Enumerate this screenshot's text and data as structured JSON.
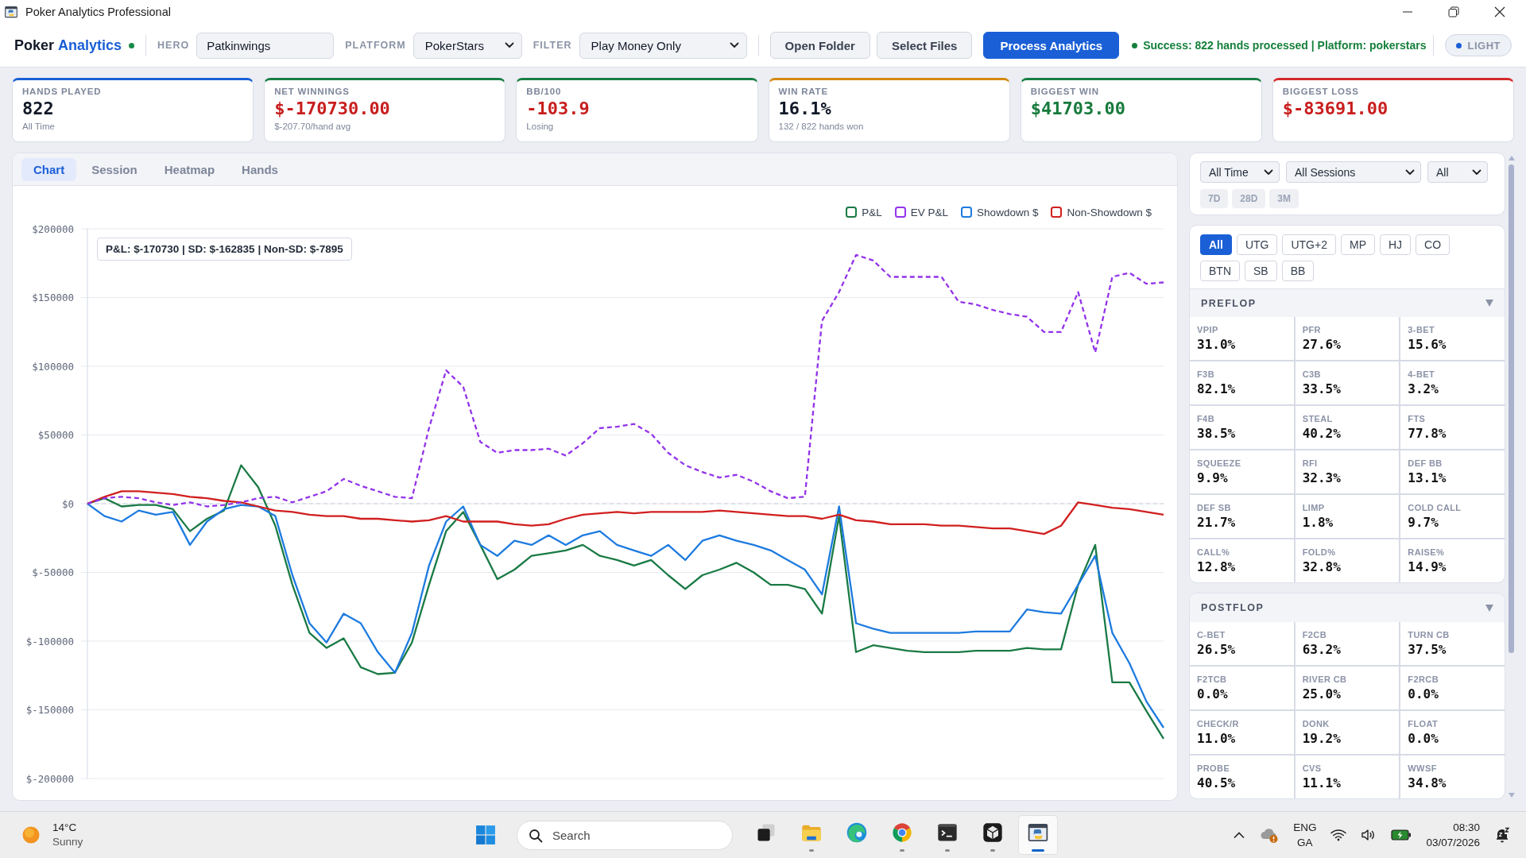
{
  "window": {
    "title": "Poker Analytics Professional"
  },
  "header": {
    "brand": {
      "name": "Poker",
      "accent": "Analytics",
      "online": true
    },
    "fields": [
      {
        "kind": "input",
        "label": "HERO",
        "value": "Patkinwings"
      },
      {
        "kind": "select",
        "label": "PLATFORM",
        "value": "PokerStars"
      },
      {
        "kind": "select",
        "label": "FILTER",
        "value": "Play Money Only"
      }
    ],
    "buttons": [
      {
        "label": "Open Folder",
        "kind": "secondary"
      },
      {
        "label": "Select Files",
        "kind": "secondary"
      },
      {
        "label": "Process Analytics",
        "kind": "primary"
      }
    ],
    "status": {
      "kind": "success",
      "text": "Success: 822 hands processed | Platform: pokerstars"
    },
    "theme_toggle": {
      "label": "LIGHT"
    }
  },
  "stats": [
    {
      "label": "HANDS PLAYED",
      "value": "822",
      "sub": "All Time",
      "color": "#1a5fd6",
      "kind": "neutral"
    },
    {
      "label": "NET WINNINGS",
      "value": "$-170730.00",
      "sub": "$-207.70/hand avg",
      "color": "#1a7f45",
      "kind": "negative"
    },
    {
      "label": "BB/100",
      "value": "-103.9",
      "sub": "Losing",
      "color": "#1a7f45",
      "kind": "negative"
    },
    {
      "label": "WIN RATE",
      "value": "16.1%",
      "sub": "132 / 822 hands won",
      "color": "#d4880f",
      "kind": "neutral"
    },
    {
      "label": "BIGGEST WIN",
      "value": "$41703.00",
      "color": "#1a7f45",
      "kind": "positive"
    },
    {
      "label": "BIGGEST LOSS",
      "value": "$-83691.00",
      "color": "#d42a2a",
      "kind": "negative"
    }
  ],
  "chart_panel": {
    "tabs": [
      {
        "label": "Chart",
        "selected": true
      },
      {
        "label": "Session",
        "selected": false
      },
      {
        "label": "Heatmap",
        "selected": false
      },
      {
        "label": "Hands",
        "selected": false
      }
    ],
    "summary": "P&L: $-170730 | SD: $-162835 | Non-SD: $-7895",
    "chart_data": {
      "type": "line",
      "categories": [
        null,
        null,
        null,
        null,
        null,
        null,
        null,
        null,
        null,
        null,
        null,
        null,
        null,
        null,
        null,
        null,
        null,
        null,
        null,
        null,
        null,
        null,
        null,
        null,
        null,
        null,
        null,
        null,
        null,
        null,
        null,
        null,
        null,
        null,
        null,
        null,
        null,
        null,
        null,
        null,
        null,
        null,
        null,
        null,
        null,
        null,
        null,
        null,
        null,
        null,
        null,
        null,
        null,
        null,
        null,
        null,
        null,
        null,
        null,
        null,
        null,
        null,
        null,
        null
      ],
      "ylim": [
        -200000,
        200000
      ],
      "yticks": [
        {
          "value": 200000,
          "label": "$200000"
        },
        {
          "value": 150000,
          "label": "$150000"
        },
        {
          "value": 100000,
          "label": "$100000"
        },
        {
          "value": 50000,
          "label": "$50000"
        },
        {
          "value": 0,
          "label": "$0"
        },
        {
          "value": -50000,
          "label": "$-50000"
        },
        {
          "value": -100000,
          "label": "$-100000"
        },
        {
          "value": -150000,
          "label": "$-150000"
        },
        {
          "value": -200000,
          "label": "$-200000"
        }
      ],
      "grid": true,
      "legend": true,
      "ref_lines": [
        {
          "axis": "y",
          "value": 0
        }
      ],
      "series": [
        {
          "name": "P&L",
          "color": "#1a7a45",
          "line_style": "solid",
          "values": [
            0,
            4000,
            -2000,
            -1000,
            -1000,
            -4000,
            -20000,
            -11000,
            -5000,
            28000,
            12000,
            -16000,
            -59000,
            -94000,
            -105000,
            -98000,
            -119000,
            -124000,
            -123000,
            -101000,
            -59000,
            -20000,
            -6000,
            -30000,
            -55000,
            -48000,
            -38000,
            -36000,
            -34000,
            -30000,
            -38000,
            -41000,
            -45000,
            -41000,
            -52000,
            -62000,
            -52000,
            -48000,
            -43000,
            -50000,
            -59000,
            -59000,
            -62000,
            -80000,
            -9000,
            -108000,
            -103000,
            -105000,
            -107000,
            -108000,
            -108000,
            -108000,
            -107000,
            -107000,
            -107000,
            -105000,
            -106000,
            -106000,
            -59000,
            -30000,
            -130000,
            -130000,
            -151000,
            -171000
          ]
        },
        {
          "name": "EV P&L",
          "color": "#9333ea",
          "line_style": "dashed",
          "values": [
            0,
            4000,
            5000,
            4000,
            1000,
            -1000,
            1000,
            -2000,
            -1000,
            1000,
            4000,
            5000,
            1000,
            5000,
            9000,
            18000,
            13000,
            9000,
            5000,
            4000,
            55000,
            97000,
            85000,
            45000,
            37000,
            39000,
            39000,
            40000,
            35000,
            44000,
            55000,
            56000,
            58000,
            51000,
            37000,
            28000,
            23000,
            19000,
            21000,
            16000,
            9000,
            4000,
            5000,
            133000,
            154000,
            181000,
            177000,
            165000,
            165000,
            165000,
            165000,
            147000,
            145000,
            141000,
            138000,
            136000,
            125000,
            125000,
            154000,
            110000,
            165000,
            168000,
            160000,
            161000
          ]
        },
        {
          "name": "Showdown $",
          "color": "#1e7be0",
          "line_style": "solid",
          "values": [
            0,
            -9000,
            -13000,
            -5000,
            -8000,
            -6000,
            -30000,
            -13000,
            -4000,
            -1000,
            -2000,
            -9000,
            -52000,
            -87000,
            -101000,
            -80000,
            -87000,
            -108000,
            -123000,
            -94000,
            -45000,
            -13000,
            -2000,
            -30000,
            -38000,
            -27000,
            -30000,
            -23000,
            -30000,
            -23000,
            -20000,
            -30000,
            -34000,
            -38000,
            -30000,
            -41000,
            -27000,
            -23000,
            -27000,
            -30000,
            -34000,
            -41000,
            -48000,
            -66000,
            -2000,
            -87000,
            -91000,
            -94000,
            -94000,
            -94000,
            -94000,
            -94000,
            -93000,
            -93000,
            -93000,
            -77000,
            -79000,
            -80000,
            -59000,
            -38000,
            -94000,
            -116000,
            -144000,
            -163000
          ]
        },
        {
          "name": "Non-Showdown $",
          "color": "#d11f1f",
          "line_style": "solid",
          "values": [
            0,
            5000,
            9000,
            9000,
            8000,
            7000,
            5000,
            4000,
            2000,
            1000,
            -2000,
            -5000,
            -6000,
            -8000,
            -9000,
            -9000,
            -11000,
            -11000,
            -12000,
            -13000,
            -12000,
            -9000,
            -13000,
            -13000,
            -13000,
            -15000,
            -16000,
            -15000,
            -11000,
            -8000,
            -7000,
            -6000,
            -7000,
            -6000,
            -6000,
            -6000,
            -6000,
            -5000,
            -6000,
            -7000,
            -8000,
            -9000,
            -9000,
            -11000,
            -8000,
            -12000,
            -13000,
            -15000,
            -15000,
            -15000,
            -16000,
            -16000,
            -17000,
            -18000,
            -18000,
            -20000,
            -22000,
            -16000,
            1000,
            -1000,
            -3000,
            -4000,
            -6000,
            -8000
          ]
        }
      ]
    }
  },
  "side_panel": {
    "filters": {
      "selects": [
        {
          "value": "All Time"
        },
        {
          "value": "All Sessions"
        },
        {
          "value": "All"
        }
      ],
      "ranges": [
        {
          "label": "7D",
          "selected": false
        },
        {
          "label": "28D",
          "selected": false
        },
        {
          "label": "3M",
          "selected": false
        }
      ]
    },
    "positions": [
      {
        "label": "All",
        "selected": true
      },
      {
        "label": "UTG",
        "selected": false
      },
      {
        "label": "UTG+2",
        "selected": false
      },
      {
        "label": "MP",
        "selected": false
      },
      {
        "label": "HJ",
        "selected": false
      },
      {
        "label": "CO",
        "selected": false
      },
      {
        "label": "BTN",
        "selected": false
      },
      {
        "label": "SB",
        "selected": false
      },
      {
        "label": "BB",
        "selected": false
      }
    ],
    "sections": [
      {
        "title": "PREFLOP",
        "expanded": true,
        "stats": [
          {
            "label": "VPIP",
            "value": "31.0%"
          },
          {
            "label": "PFR",
            "value": "27.6%"
          },
          {
            "label": "3-BET",
            "value": "15.6%"
          },
          {
            "label": "F3B",
            "value": "82.1%"
          },
          {
            "label": "C3B",
            "value": "33.5%"
          },
          {
            "label": "4-BET",
            "value": "3.2%"
          },
          {
            "label": "F4B",
            "value": "38.5%"
          },
          {
            "label": "STEAL",
            "value": "40.2%"
          },
          {
            "label": "FTS",
            "value": "77.8%"
          },
          {
            "label": "SQUEEZE",
            "value": "9.9%"
          },
          {
            "label": "RFI",
            "value": "32.3%"
          },
          {
            "label": "DEF BB",
            "value": "13.1%"
          },
          {
            "label": "DEF SB",
            "value": "21.7%"
          },
          {
            "label": "LIMP",
            "value": "1.8%"
          },
          {
            "label": "COLD CALL",
            "value": "9.7%"
          },
          {
            "label": "CALL%",
            "value": "12.8%"
          },
          {
            "label": "FOLD%",
            "value": "32.8%"
          },
          {
            "label": "RAISE%",
            "value": "14.9%"
          }
        ]
      },
      {
        "title": "POSTFLOP",
        "expanded": true,
        "stats": [
          {
            "label": "C-BET",
            "value": "26.5%"
          },
          {
            "label": "F2CB",
            "value": "63.2%"
          },
          {
            "label": "TURN CB",
            "value": "37.5%"
          },
          {
            "label": "F2TCB",
            "value": "0.0%"
          },
          {
            "label": "RIVER CB",
            "value": "25.0%"
          },
          {
            "label": "F2RCB",
            "value": "0.0%"
          },
          {
            "label": "CHECK/R",
            "value": "11.0%"
          },
          {
            "label": "DONK",
            "value": "19.2%"
          },
          {
            "label": "FLOAT",
            "value": "0.0%"
          },
          {
            "label": "PROBE",
            "value": "40.5%"
          },
          {
            "label": "CVS",
            "value": "11.1%"
          },
          {
            "label": "WWSF",
            "value": "34.8%"
          }
        ]
      }
    ]
  },
  "taskbar": {
    "weather": {
      "temperature": "14°C",
      "condition": "Sunny"
    },
    "search": {
      "placeholder": "Search"
    },
    "apps": [
      {
        "kind": "taskview",
        "running": false,
        "selected": false
      },
      {
        "kind": "folder",
        "running": true,
        "selected": false
      },
      {
        "kind": "swirl",
        "running": false,
        "selected": false
      },
      {
        "kind": "wheel",
        "running": true,
        "selected": false
      },
      {
        "kind": "terminal",
        "running": true,
        "selected": false
      },
      {
        "kind": "cube",
        "running": true,
        "selected": false
      },
      {
        "kind": "appwindow",
        "running": true,
        "selected": true
      }
    ],
    "tray": {
      "language": "ENG",
      "layout": "GA",
      "time": "08:30",
      "date": "03/07/2026"
    }
  }
}
